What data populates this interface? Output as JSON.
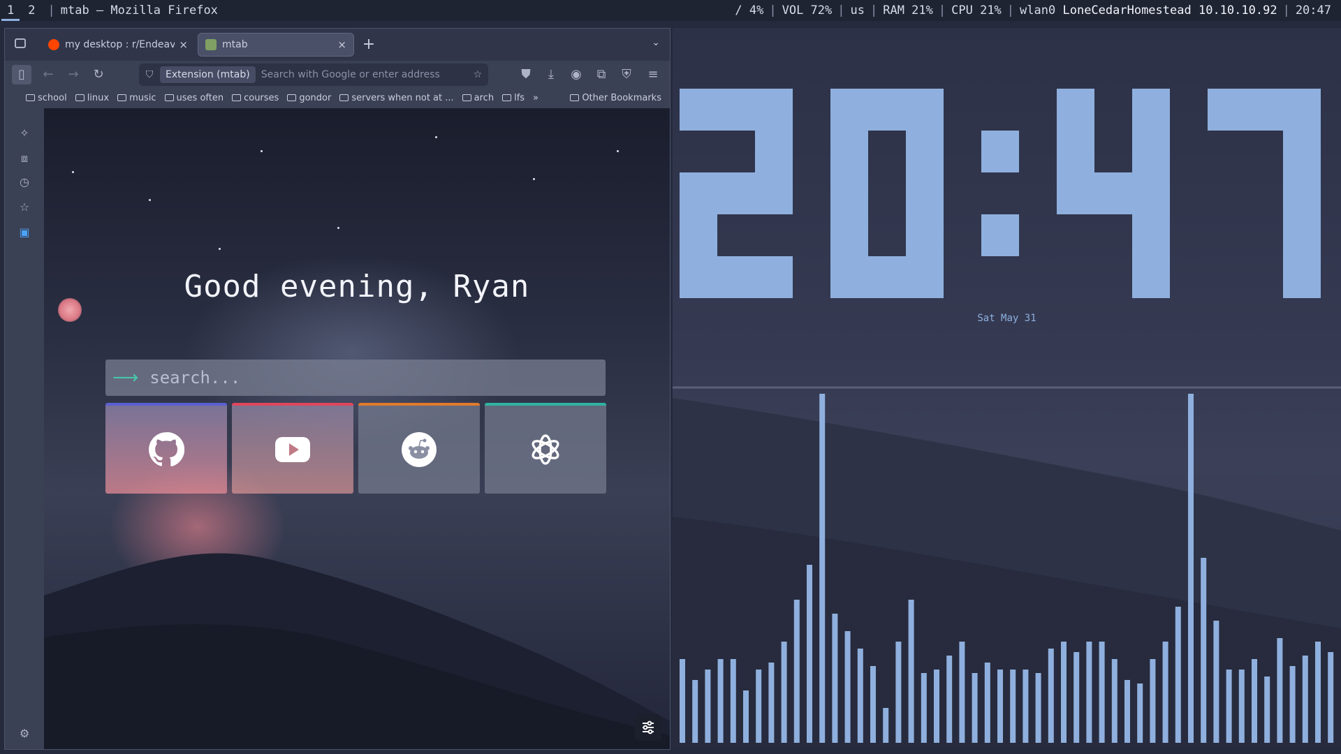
{
  "statusbar": {
    "workspaces": [
      "1",
      "2"
    ],
    "active_workspace": "1",
    "window_title": "mtab — Mozilla Firefox",
    "disk": "/ 4%",
    "vol": "VOL 72%",
    "layout": "us",
    "ram": "RAM 21%",
    "cpu": "CPU 21%",
    "iface": "wlan0",
    "ssid": "LoneCedarHomestead",
    "ip": "10.10.10.92",
    "time": "20:47"
  },
  "browser": {
    "tabs": [
      {
        "title": "my desktop : r/Endeavour",
        "close": "×"
      },
      {
        "title": "mtab",
        "close": "×"
      }
    ],
    "new_tab": "+",
    "url_chip": "Extension (mtab)",
    "url_placeholder": "Search with Google or enter address",
    "bookmarks": [
      "school",
      "linux",
      "music",
      "uses often",
      "courses",
      "gondor",
      "servers when not at ...",
      "arch",
      "lfs"
    ],
    "overflow": "»",
    "other_bookmarks": "Other Bookmarks"
  },
  "newtab": {
    "greeting": "Good evening, Ryan",
    "search_placeholder": "search...",
    "quick_links": [
      {
        "name": "github",
        "accent": "#5b5fd1"
      },
      {
        "name": "youtube",
        "accent": "#e0475b"
      },
      {
        "name": "reddit",
        "accent": "#e07a2c"
      },
      {
        "name": "openai",
        "accent": "#2fb3a3"
      }
    ]
  },
  "clock": {
    "time": "20:47",
    "date": "Sat May 31",
    "color": "#8fb0de"
  },
  "visualizer": {
    "color": "#8fb0de",
    "bars": [
      0.24,
      0.18,
      0.21,
      0.24,
      0.24,
      0.15,
      0.21,
      0.23,
      0.29,
      0.41,
      0.51,
      1.0,
      0.37,
      0.32,
      0.27,
      0.22,
      0.1,
      0.29,
      0.41,
      0.2,
      0.21,
      0.25,
      0.29,
      0.2,
      0.23,
      0.21,
      0.21,
      0.21,
      0.2,
      0.27,
      0.29,
      0.26,
      0.29,
      0.29,
      0.24,
      0.18,
      0.17,
      0.24,
      0.29,
      0.39,
      1.0,
      0.53,
      0.35,
      0.21,
      0.21,
      0.24,
      0.19,
      0.3,
      0.22,
      0.25,
      0.29,
      0.26
    ]
  }
}
